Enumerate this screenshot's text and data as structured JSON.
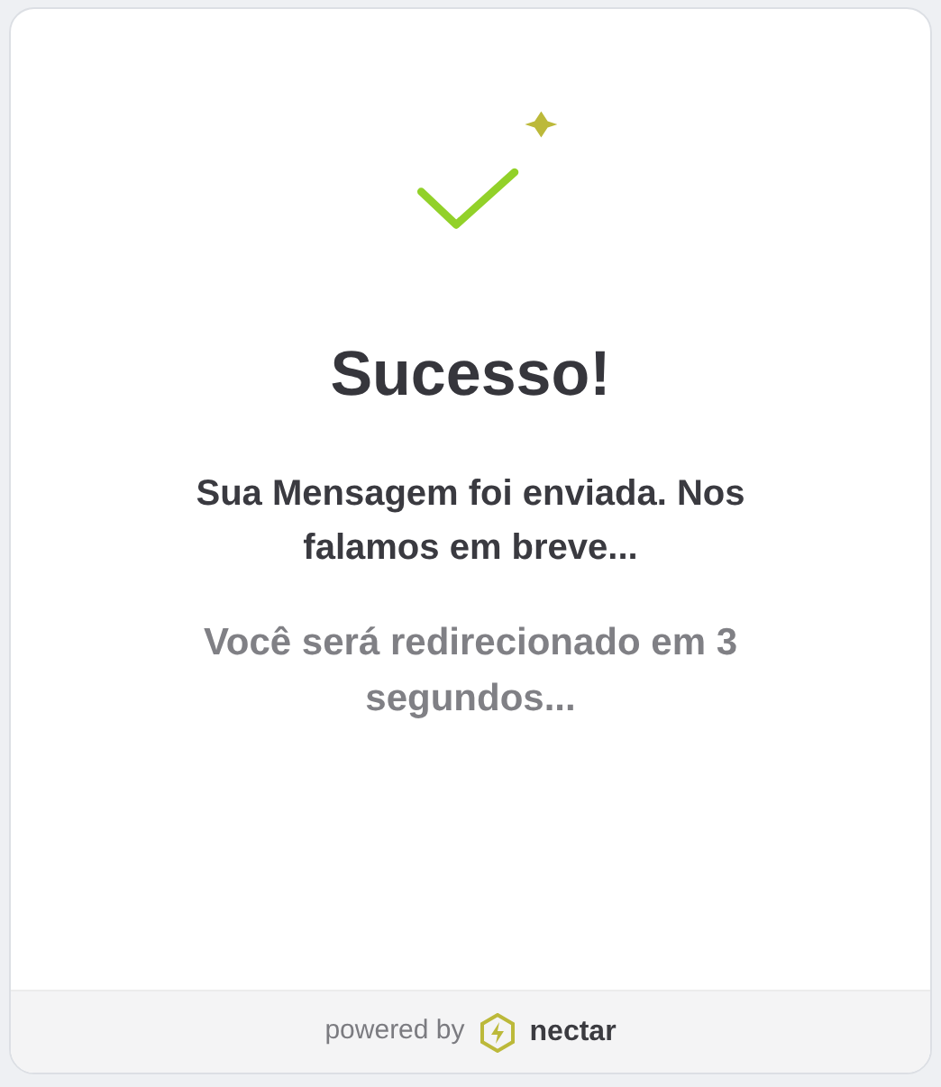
{
  "title": "Sucesso!",
  "message": "Sua Mensagem foi enviada. Nos falamos em breve...",
  "redirect": "Você será redirecionado em 3 segundos...",
  "footer": {
    "powered_by": "powered by",
    "brand": "nectar"
  }
}
